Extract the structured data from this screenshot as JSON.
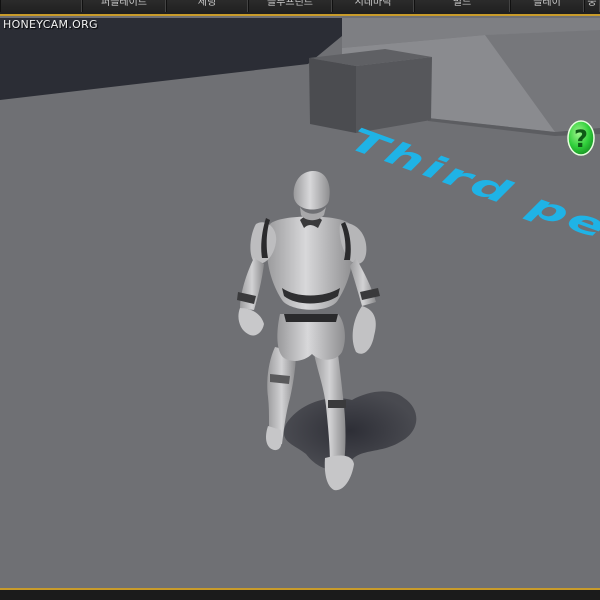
{
  "watermark": "HONEYCAM.ORG",
  "toolbar": {
    "buttons": [
      {
        "label": "퍼블레이트"
      },
      {
        "label": "세팅"
      },
      {
        "label": "블루프린트"
      },
      {
        "label": "시네마틱"
      },
      {
        "label": "빌드"
      },
      {
        "label": "플레이"
      },
      {
        "label": "중"
      }
    ]
  },
  "scene": {
    "floor_text": "Third pe",
    "help_icon_glyph": "?",
    "colors": {
      "floor": "#6f7074",
      "wall": "#2a2c34",
      "accent": "#c89b2a",
      "floor_text": "#1fb3e6",
      "help_icon": "#2fcf3a"
    }
  }
}
